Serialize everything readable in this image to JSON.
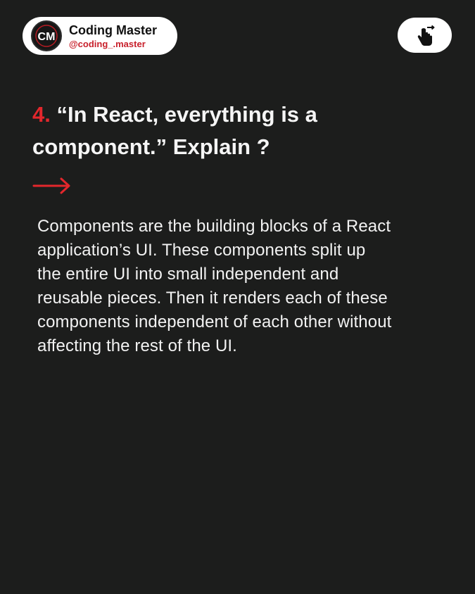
{
  "profile": {
    "name": "Coding Master",
    "handle": "@coding_.master",
    "avatar_initials": "CM",
    "avatar_icon": "brand-logo-icon"
  },
  "swipe": {
    "icon": "swipe-hand-icon"
  },
  "question": {
    "number": "4.",
    "text_line1": "“In React, everything is a",
    "text_line2": "component.” Explain ?"
  },
  "arrow": {
    "icon": "right-arrow-icon"
  },
  "answer": {
    "lines": [
      "Components are the building blocks of a React",
      "application’s UI. These components split up",
      "the entire UI into small independent and",
      "reusable pieces. Then it renders each of these",
      "components independent of each other without",
      "affecting the rest of the UI."
    ]
  },
  "colors": {
    "background": "#1c1d1c",
    "accent": "#e3272c",
    "text": "#f4f4f4"
  }
}
